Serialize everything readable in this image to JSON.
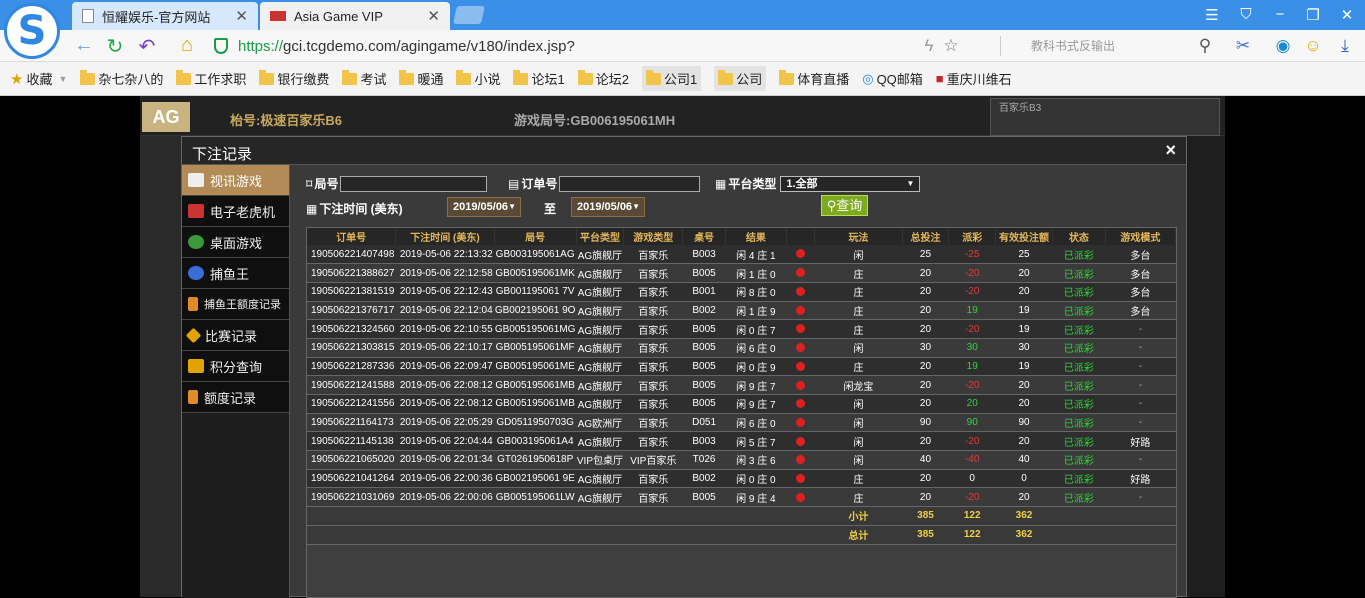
{
  "browser": {
    "tabs": [
      {
        "title": "恒耀娱乐-官方网站"
      },
      {
        "title": "Asia Game VIP"
      }
    ],
    "url_proto": "https://",
    "url_rest": "gci.tcgdemo.com/agingame/v180/index.jsp?",
    "search_placeholder": "教科书式反输出",
    "bookmarks": [
      "收藏",
      "杂七杂八的",
      "工作求职",
      "银行缴费",
      "考试",
      "暖通",
      "小说",
      "论坛1",
      "论坛2",
      "公司1",
      "公司",
      "体育直播",
      "QQ邮箱",
      "重庆川维石"
    ]
  },
  "game": {
    "logo": "AG",
    "table_title": "枱号:极速百家乐B6",
    "game_no": "游戏局号:GB006195061MH",
    "right_label": "百家乐B3"
  },
  "modal": {
    "title": "下注记录",
    "close": "×",
    "menu": [
      "视讯游戏",
      "电子老虎机",
      "桌面游戏",
      "捕鱼王",
      "捕鱼王额度记录",
      "比赛记录",
      "积分查询",
      "额度记录"
    ],
    "filters": {
      "round_label": "局号",
      "order_label": "订单号",
      "platform_label": "平台类型",
      "platform_value": "1.全部",
      "time_label": "下注时间 (美东)",
      "date_from": "2019/05/06",
      "to_label": "至",
      "date_to": "2019/05/06",
      "query_label": "查询"
    },
    "columns": [
      "订单号",
      "下注时间 (美东)",
      "局号",
      "平台类型",
      "游戏类型",
      "桌号",
      "结果",
      "",
      "玩法",
      "总投注",
      "派彩",
      "有效投注额",
      "状态",
      "游戏模式"
    ],
    "rows": [
      [
        "190506221407498",
        "2019-05-06 22:13:32",
        "GB003195061AG",
        "AG旗舰厅",
        "百家乐",
        "B003",
        "闲 4 庄 1",
        "闲",
        "25",
        "-25",
        "25",
        "已派彩",
        "多台"
      ],
      [
        "190506221388627",
        "2019-05-06 22:12:58",
        "GB005195061MK",
        "AG旗舰厅",
        "百家乐",
        "B005",
        "闲 1 庄 0",
        "庄",
        "20",
        "-20",
        "20",
        "已派彩",
        "多台"
      ],
      [
        "190506221381519",
        "2019-05-06 22:12:43",
        "GB001195061 7V",
        "AG旗舰厅",
        "百家乐",
        "B001",
        "闲 8 庄 0",
        "庄",
        "20",
        "-20",
        "20",
        "已派彩",
        "多台"
      ],
      [
        "190506221376717",
        "2019-05-06 22:12:04",
        "GB002195061 9O",
        "AG旗舰厅",
        "百家乐",
        "B002",
        "闲 1 庄 9",
        "庄",
        "20",
        "19",
        "19",
        "已派彩",
        "多台"
      ],
      [
        "190506221324560",
        "2019-05-06 22:10:55",
        "GB005195061MG",
        "AG旗舰厅",
        "百家乐",
        "B005",
        "闲 0 庄 7",
        "庄",
        "20",
        "-20",
        "19",
        "已派彩",
        "-"
      ],
      [
        "190506221303815",
        "2019-05-06 22:10:17",
        "GB005195061MF",
        "AG旗舰厅",
        "百家乐",
        "B005",
        "闲 6 庄 0",
        "闲",
        "30",
        "30",
        "30",
        "已派彩",
        "-"
      ],
      [
        "190506221287336",
        "2019-05-06 22:09:47",
        "GB005195061ME",
        "AG旗舰厅",
        "百家乐",
        "B005",
        "闲 0 庄 9",
        "庄",
        "20",
        "19",
        "19",
        "已派彩",
        "-"
      ],
      [
        "190506221241588",
        "2019-05-06 22:08:12",
        "GB005195061MB",
        "AG旗舰厅",
        "百家乐",
        "B005",
        "闲 9 庄 7",
        "闲龙宝",
        "20",
        "-20",
        "20",
        "已派彩",
        "-"
      ],
      [
        "190506221241556",
        "2019-05-06 22:08:12",
        "GB005195061MB",
        "AG旗舰厅",
        "百家乐",
        "B005",
        "闲 9 庄 7",
        "闲",
        "20",
        "20",
        "20",
        "已派彩",
        "-"
      ],
      [
        "190506221164173",
        "2019-05-06 22:05:29",
        "GD0511950703G",
        "AG欧洲厅",
        "百家乐",
        "D051",
        "闲 6 庄 0",
        "闲",
        "90",
        "90",
        "90",
        "已派彩",
        "-"
      ],
      [
        "190506221145138",
        "2019-05-06 22:04:44",
        "GB003195061A4",
        "AG旗舰厅",
        "百家乐",
        "B003",
        "闲 5 庄 7",
        "闲",
        "20",
        "-20",
        "20",
        "已派彩",
        "好路"
      ],
      [
        "190506221065020",
        "2019-05-06 22:01:34",
        "GT0261950618P",
        "VIP包桌厅",
        "VIP百家乐",
        "T026",
        "闲 3 庄 6",
        "闲",
        "40",
        "-40",
        "40",
        "已派彩",
        "-"
      ],
      [
        "190506221041264",
        "2019-05-06 22:00:36",
        "GB002195061 9E",
        "AG旗舰厅",
        "百家乐",
        "B002",
        "闲 0 庄 0",
        "庄",
        "20",
        "0",
        "0",
        "已派彩",
        "好路"
      ],
      [
        "190506221031069",
        "2019-05-06 22:00:06",
        "GB005195061LW",
        "AG旗舰厅",
        "百家乐",
        "B005",
        "闲 9 庄 4",
        "庄",
        "20",
        "-20",
        "20",
        "已派彩",
        "-"
      ]
    ],
    "subtotal": {
      "label": "小计",
      "bet": "385",
      "payout": "122",
      "valid": "362"
    },
    "total": {
      "label": "总计",
      "bet": "385",
      "payout": "122",
      "valid": "362"
    }
  }
}
